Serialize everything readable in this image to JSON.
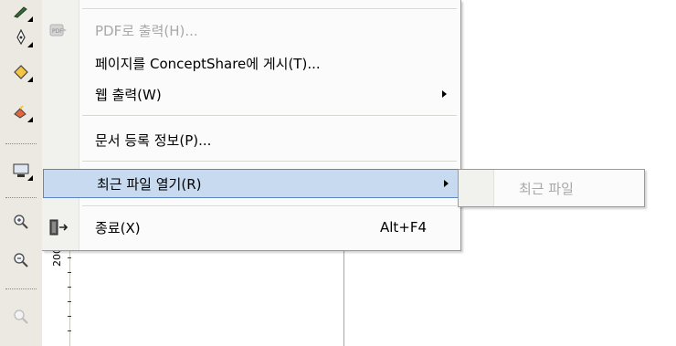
{
  "toolbox": {
    "tools": [
      {
        "icon": "pen-tool-icon"
      },
      {
        "icon": "outline-pen-icon"
      },
      {
        "icon": "fill-bucket-icon"
      },
      {
        "icon": "interactive-fill-icon"
      },
      {
        "icon": "connector-icon"
      },
      {
        "icon": "zoom-in-icon"
      },
      {
        "icon": "zoom-out-icon"
      },
      {
        "icon": "zoom-disabled-icon"
      }
    ]
  },
  "ruler": {
    "label": "200"
  },
  "menu": {
    "items": [
      {
        "label": "PDF로 출력(H)...",
        "icon": "pdf-icon",
        "enabled": false
      },
      {
        "label": "페이지를 ConceptShare에 게시(T)...",
        "enabled": true
      },
      {
        "label": "웹 출력(W)",
        "enabled": true,
        "submenu": true
      },
      {
        "label": "문서 등록 정보(P)...",
        "enabled": true
      },
      {
        "label": "최근 파일 열기(R)",
        "enabled": true,
        "submenu": true,
        "highlighted": true
      },
      {
        "label": "종료(X)",
        "icon": "exit-door-icon",
        "shortcut": "Alt+F4",
        "enabled": true
      }
    ]
  },
  "submenu": {
    "label": "최근 파일",
    "enabled": false
  },
  "colors": {
    "highlight": "#c8daf0",
    "highlight_border": "#5b86c3",
    "disabled": "#a8a8a8"
  }
}
